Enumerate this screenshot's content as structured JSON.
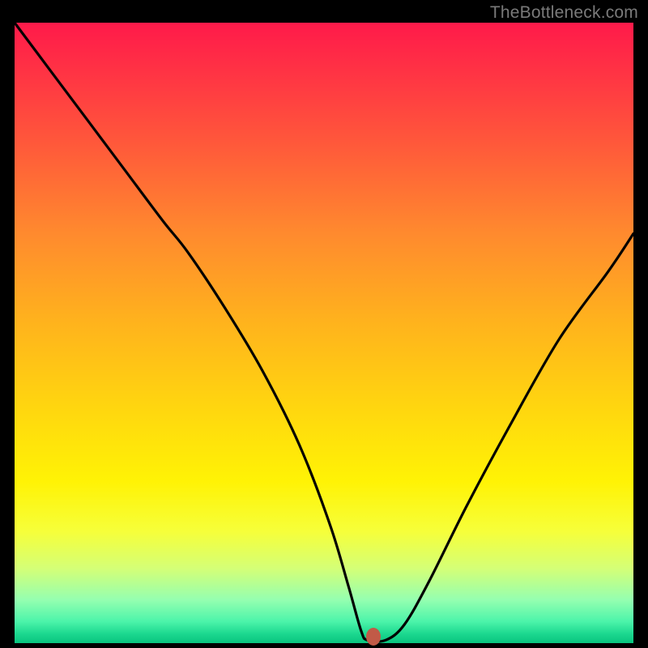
{
  "watermark": {
    "text": "TheBottleneck.com"
  },
  "marker": {
    "x_pct": 58.0,
    "y_pct": 99.0
  },
  "chart_data": {
    "type": "line",
    "title": "",
    "xlabel": "",
    "ylabel": "",
    "xlim": [
      0,
      100
    ],
    "ylim": [
      0,
      100
    ],
    "grid": false,
    "series": [
      {
        "name": "bottleneck-curve",
        "x": [
          0,
          6,
          12,
          18,
          24,
          28,
          34,
          40,
          46,
          51,
          54,
          56,
          57,
          60,
          63,
          67,
          73,
          80,
          88,
          96,
          100
        ],
        "y": [
          100,
          92,
          84,
          76,
          68,
          63,
          54,
          44,
          32,
          19,
          9,
          2,
          0.5,
          0.5,
          3,
          10,
          22,
          35,
          49,
          60,
          66
        ]
      }
    ],
    "marker_point": {
      "x": 58,
      "y": 0.8
    },
    "background_gradient": {
      "top_color": "#ff1a4a",
      "bottom_color": "#09c47f",
      "stops": [
        {
          "pct": 0,
          "color": "#ff1a4a"
        },
        {
          "pct": 20,
          "color": "#ff5a3a"
        },
        {
          "pct": 48,
          "color": "#ffb21d"
        },
        {
          "pct": 74,
          "color": "#fff305"
        },
        {
          "pct": 93,
          "color": "#95ffb0"
        },
        {
          "pct": 100,
          "color": "#09c47f"
        }
      ]
    }
  }
}
